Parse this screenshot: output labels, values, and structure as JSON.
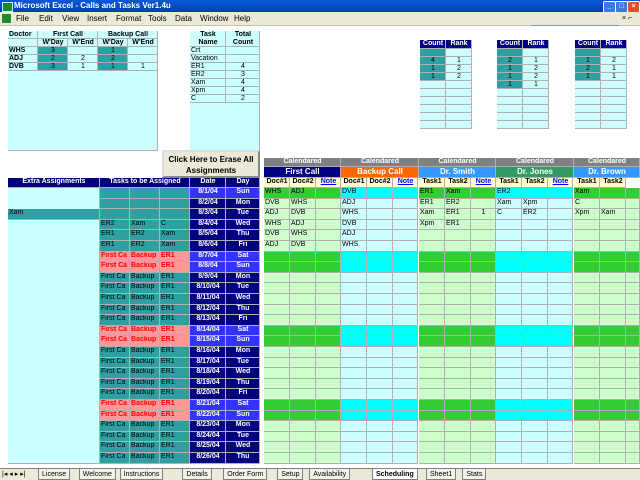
{
  "window": {
    "title": "Microsoft Excel - Calls and Tasks Ver1.4u"
  },
  "menu": [
    "File",
    "Edit",
    "View",
    "Insert",
    "Format",
    "Tools",
    "Data",
    "Window",
    "Help"
  ],
  "help_placeholder": "Type a question for help",
  "doctor_table": {
    "headers": [
      "Doctor",
      "First Call",
      "Backup Call"
    ],
    "subheaders": [
      "W'Day",
      "W'End",
      "W'Day",
      "W'End"
    ],
    "rows": [
      {
        "name": "WHS",
        "v": [
          "3",
          "",
          "1",
          ""
        ]
      },
      {
        "name": "ADJ",
        "v": [
          "2",
          "2",
          "2",
          ""
        ]
      },
      {
        "name": "DVB",
        "v": [
          "3",
          "1",
          "1",
          "1"
        ]
      }
    ]
  },
  "task_table": {
    "headers": [
      "Task Name",
      "Total Count"
    ],
    "rows": [
      [
        "Crt",
        ""
      ],
      [
        "Vacation",
        ""
      ],
      [
        "ER1",
        "4"
      ],
      [
        "ER2",
        "3"
      ],
      [
        "Xam",
        "4"
      ],
      [
        "Xpm",
        "4"
      ],
      [
        "C",
        "2"
      ]
    ]
  },
  "count_rank": {
    "labels": [
      "Count",
      "Rank"
    ],
    "panels": [
      [
        [
          "",
          ""
        ],
        [
          "4",
          "1"
        ],
        [
          "1",
          "2"
        ],
        [
          "1",
          "2"
        ]
      ],
      [
        [
          "",
          ""
        ],
        [
          "2",
          "1"
        ],
        [
          "1",
          "2"
        ],
        [
          "1",
          "2"
        ],
        [
          "1",
          "1"
        ]
      ],
      [
        [
          "",
          ""
        ],
        [
          "1",
          "2"
        ],
        [
          "2",
          "1"
        ],
        [
          "1",
          "1"
        ]
      ]
    ]
  },
  "erase_button": "Click Here to Erase All Assignments",
  "col_headers": {
    "extra": "Extra Assignments",
    "tasks": "Tasks to be Assigned",
    "date": "Date",
    "day": "Day",
    "calendared": "Calendared",
    "first_call": "First Call",
    "backup_call": "Backup Call",
    "dr_smith": "Dr. Smith",
    "dr_jones": "Dr. Jones",
    "dr_brown": "Dr. Brown",
    "doc1": "Doc#1",
    "doc2": "Doc#2",
    "note": "Note",
    "task1": "Task1",
    "task2": "Task2"
  },
  "xam_label": "Xam",
  "rows": [
    {
      "date": "8/1/04",
      "day": "Sun",
      "weekend": true,
      "t": [
        "",
        "",
        ""
      ],
      "fc": [
        "WHS",
        "ADJ"
      ],
      "bc": [
        "DVB",
        ""
      ],
      "sm": [
        "ER1",
        "Xam"
      ],
      "jo": [
        "ER2",
        ""
      ],
      "br": [
        "Xam",
        ""
      ]
    },
    {
      "date": "8/2/04",
      "day": "Mon",
      "weekend": false,
      "t": [
        "",
        "",
        ""
      ],
      "fc": [
        "DVB",
        "WHS"
      ],
      "bc": [
        "ADJ",
        ""
      ],
      "sm": [
        "ER1",
        "ER2"
      ],
      "jo": [
        "Xam",
        "Xpm"
      ],
      "br": [
        "C",
        ""
      ]
    },
    {
      "date": "8/3/04",
      "day": "Tue",
      "weekend": false,
      "t": [
        "",
        "",
        ""
      ],
      "fc": [
        "ADJ",
        "DVB"
      ],
      "bc": [
        "WHS",
        ""
      ],
      "sm": [
        "Xam",
        "ER1"
      ],
      "smn": "1",
      "jo": [
        "C",
        "ER2"
      ],
      "br": [
        "Xpm",
        "Xam"
      ]
    },
    {
      "date": "8/4/04",
      "day": "Wed",
      "weekend": false,
      "t": [
        "ER2",
        "Xam",
        "C"
      ],
      "fc": [
        "WHS",
        "ADJ"
      ],
      "bc": [
        "DVB",
        ""
      ],
      "sm": [
        "Xpm",
        "ER1"
      ],
      "jo": [
        "",
        ""
      ],
      "br": [
        "",
        ""
      ]
    },
    {
      "date": "8/5/04",
      "day": "Thu",
      "weekend": false,
      "t": [
        "ER1",
        "ER2",
        "Xam"
      ],
      "fc": [
        "DVB",
        "WHS"
      ],
      "bc": [
        "ADJ",
        ""
      ],
      "sm": [
        "",
        ""
      ],
      "jo": [
        "",
        ""
      ],
      "br": [
        "",
        ""
      ]
    },
    {
      "date": "8/6/04",
      "day": "Fri",
      "weekend": false,
      "t": [
        "ER1",
        "ER2",
        "Xam"
      ],
      "fc": [
        "ADJ",
        "DVB"
      ],
      "bc": [
        "WHS",
        ""
      ],
      "sm": [
        "",
        ""
      ],
      "jo": [
        "",
        ""
      ],
      "br": [
        "",
        ""
      ]
    },
    {
      "date": "8/7/04",
      "day": "Sat",
      "weekend": true,
      "t": [
        "First Ca",
        "Backup",
        "ER1"
      ],
      "fc": [
        "",
        ""
      ],
      "bc": [
        "",
        ""
      ],
      "sm": [
        "",
        ""
      ],
      "jo": [
        "",
        ""
      ],
      "br": [
        "",
        ""
      ]
    },
    {
      "date": "8/8/04",
      "day": "Sun",
      "weekend": true,
      "t": [
        "First Ca",
        "Backup",
        "ER1"
      ],
      "fc": [
        "",
        ""
      ],
      "bc": [
        "",
        ""
      ],
      "sm": [
        "",
        ""
      ],
      "jo": [
        "",
        ""
      ],
      "br": [
        "",
        ""
      ]
    },
    {
      "date": "8/9/04",
      "day": "Mon",
      "weekend": false,
      "t": [
        "First Ca",
        "Backup",
        "ER1"
      ],
      "fc": [
        "",
        ""
      ],
      "bc": [
        "",
        ""
      ],
      "sm": [
        "",
        ""
      ],
      "jo": [
        "",
        ""
      ],
      "br": [
        "",
        ""
      ]
    },
    {
      "date": "8/10/04",
      "day": "Tue",
      "weekend": false,
      "t": [
        "First Ca",
        "Backup",
        "ER1"
      ],
      "fc": [
        "",
        ""
      ],
      "bc": [
        "",
        ""
      ],
      "sm": [
        "",
        ""
      ],
      "jo": [
        "",
        ""
      ],
      "br": [
        "",
        ""
      ]
    },
    {
      "date": "8/11/04",
      "day": "Wed",
      "weekend": false,
      "t": [
        "First Ca",
        "Backup",
        "ER1"
      ],
      "fc": [
        "",
        ""
      ],
      "bc": [
        "",
        ""
      ],
      "sm": [
        "",
        ""
      ],
      "jo": [
        "",
        ""
      ],
      "br": [
        "",
        ""
      ]
    },
    {
      "date": "8/12/04",
      "day": "Thu",
      "weekend": false,
      "t": [
        "First Ca",
        "Backup",
        "ER1"
      ],
      "fc": [
        "",
        ""
      ],
      "bc": [
        "",
        ""
      ],
      "sm": [
        "",
        ""
      ],
      "jo": [
        "",
        ""
      ],
      "br": [
        "",
        ""
      ]
    },
    {
      "date": "8/13/04",
      "day": "Fri",
      "weekend": false,
      "t": [
        "First Ca",
        "Backup",
        "ER1"
      ],
      "fc": [
        "",
        ""
      ],
      "bc": [
        "",
        ""
      ],
      "sm": [
        "",
        ""
      ],
      "jo": [
        "",
        ""
      ],
      "br": [
        "",
        ""
      ]
    },
    {
      "date": "8/14/04",
      "day": "Sat",
      "weekend": true,
      "t": [
        "First Ca",
        "Backup",
        "ER1"
      ],
      "fc": [
        "",
        ""
      ],
      "bc": [
        "",
        ""
      ],
      "sm": [
        "",
        ""
      ],
      "jo": [
        "",
        ""
      ],
      "br": [
        "",
        ""
      ]
    },
    {
      "date": "8/15/04",
      "day": "Sun",
      "weekend": true,
      "t": [
        "First Ca",
        "Backup",
        "ER1"
      ],
      "fc": [
        "",
        ""
      ],
      "bc": [
        "",
        ""
      ],
      "sm": [
        "",
        ""
      ],
      "jo": [
        "",
        ""
      ],
      "br": [
        "",
        ""
      ]
    },
    {
      "date": "8/16/04",
      "day": "Mon",
      "weekend": false,
      "t": [
        "First Ca",
        "Backup",
        "ER1"
      ],
      "fc": [
        "",
        ""
      ],
      "bc": [
        "",
        ""
      ],
      "sm": [
        "",
        ""
      ],
      "jo": [
        "",
        ""
      ],
      "br": [
        "",
        ""
      ]
    },
    {
      "date": "8/17/04",
      "day": "Tue",
      "weekend": false,
      "t": [
        "First Ca",
        "Backup",
        "ER1"
      ],
      "fc": [
        "",
        ""
      ],
      "bc": [
        "",
        ""
      ],
      "sm": [
        "",
        ""
      ],
      "jo": [
        "",
        ""
      ],
      "br": [
        "",
        ""
      ]
    },
    {
      "date": "8/18/04",
      "day": "Wed",
      "weekend": false,
      "t": [
        "First Ca",
        "Backup",
        "ER1"
      ],
      "fc": [
        "",
        ""
      ],
      "bc": [
        "",
        ""
      ],
      "sm": [
        "",
        ""
      ],
      "jo": [
        "",
        ""
      ],
      "br": [
        "",
        ""
      ]
    },
    {
      "date": "8/19/04",
      "day": "Thu",
      "weekend": false,
      "t": [
        "First Ca",
        "Backup",
        "ER1"
      ],
      "fc": [
        "",
        ""
      ],
      "bc": [
        "",
        ""
      ],
      "sm": [
        "",
        ""
      ],
      "jo": [
        "",
        ""
      ],
      "br": [
        "",
        ""
      ]
    },
    {
      "date": "8/20/04",
      "day": "Fri",
      "weekend": false,
      "t": [
        "First Ca",
        "Backup",
        "ER1"
      ],
      "fc": [
        "",
        ""
      ],
      "bc": [
        "",
        ""
      ],
      "sm": [
        "",
        ""
      ],
      "jo": [
        "",
        ""
      ],
      "br": [
        "",
        ""
      ]
    },
    {
      "date": "8/21/04",
      "day": "Sat",
      "weekend": true,
      "t": [
        "First Ca",
        "Backup",
        "ER1"
      ],
      "fc": [
        "",
        ""
      ],
      "bc": [
        "",
        ""
      ],
      "sm": [
        "",
        ""
      ],
      "jo": [
        "",
        ""
      ],
      "br": [
        "",
        ""
      ]
    },
    {
      "date": "8/22/04",
      "day": "Sun",
      "weekend": true,
      "t": [
        "First Ca",
        "Backup",
        "ER1"
      ],
      "fc": [
        "",
        ""
      ],
      "bc": [
        "",
        ""
      ],
      "sm": [
        "",
        ""
      ],
      "jo": [
        "",
        ""
      ],
      "br": [
        "",
        ""
      ]
    },
    {
      "date": "8/23/04",
      "day": "Mon",
      "weekend": false,
      "t": [
        "First Ca",
        "Backup",
        "ER1"
      ],
      "fc": [
        "",
        ""
      ],
      "bc": [
        "",
        ""
      ],
      "sm": [
        "",
        ""
      ],
      "jo": [
        "",
        ""
      ],
      "br": [
        "",
        ""
      ]
    },
    {
      "date": "8/24/04",
      "day": "Tue",
      "weekend": false,
      "t": [
        "First Ca",
        "Backup",
        "ER1"
      ],
      "fc": [
        "",
        ""
      ],
      "bc": [
        "",
        ""
      ],
      "sm": [
        "",
        ""
      ],
      "jo": [
        "",
        ""
      ],
      "br": [
        "",
        ""
      ]
    },
    {
      "date": "8/25/04",
      "day": "Wed",
      "weekend": false,
      "t": [
        "First Ca",
        "Backup",
        "ER1"
      ],
      "fc": [
        "",
        ""
      ],
      "bc": [
        "",
        ""
      ],
      "sm": [
        "",
        ""
      ],
      "jo": [
        "",
        ""
      ],
      "br": [
        "",
        ""
      ]
    },
    {
      "date": "8/26/04",
      "day": "Thu",
      "weekend": false,
      "t": [
        "First Ca",
        "Backup",
        "ER1"
      ],
      "fc": [
        "",
        ""
      ],
      "bc": [
        "",
        ""
      ],
      "sm": [
        "",
        ""
      ],
      "jo": [
        "",
        ""
      ],
      "br": [
        "",
        ""
      ]
    }
  ],
  "tabs": [
    "License",
    "Welcome",
    "Instructions",
    "Details",
    "Order Form",
    "Setup",
    "Availability",
    "Scheduling",
    "Sheet1",
    "Stats"
  ],
  "active_tab": "Scheduling",
  "colors": {
    "navy": "#000080",
    "teal": "#2f9fa3",
    "lightblue": "#ccffff",
    "green": "#33cc33",
    "cyan": "#00ffff",
    "orange": "#ff6600",
    "smith": "#3399ff",
    "jones": "#339966",
    "grey": "#808080"
  }
}
